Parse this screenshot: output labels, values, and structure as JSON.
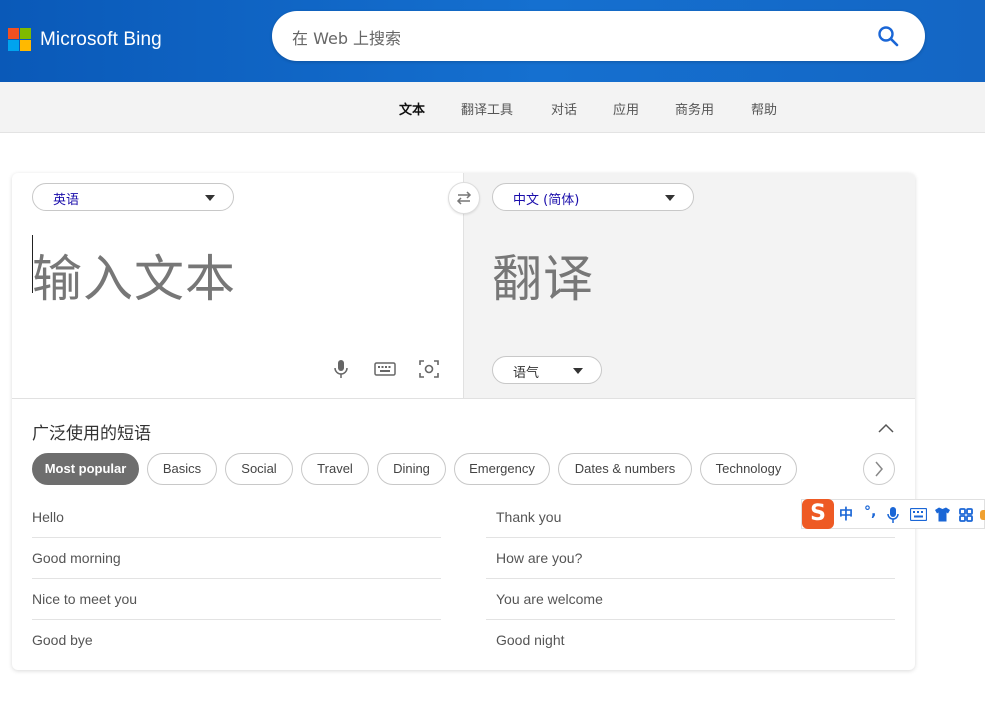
{
  "header": {
    "brand": "Microsoft Bing",
    "search_placeholder": "在 Web 上搜索",
    "logo_colors": [
      "#f25022",
      "#7fba00",
      "#00a4ef",
      "#ffb900"
    ]
  },
  "nav": {
    "items": [
      {
        "label": "文本",
        "active": true
      },
      {
        "label": "翻译工具"
      },
      {
        "label": "对话"
      },
      {
        "label": "应用"
      },
      {
        "label": "商务用"
      },
      {
        "label": "帮助"
      }
    ]
  },
  "translator": {
    "source_lang": "英语",
    "target_lang": "中文 (简体)",
    "source_placeholder": "输入文本",
    "target_placeholder": "翻译",
    "tone_label": "语气",
    "icons": [
      "microphone-icon",
      "keyboard-icon",
      "camera-scan-icon",
      "swap-icon"
    ]
  },
  "phrases": {
    "title": "广泛使用的短语",
    "categories": [
      "Most popular",
      "Basics",
      "Social",
      "Travel",
      "Dining",
      "Emergency",
      "Dates & numbers",
      "Technology"
    ],
    "left": [
      "Hello",
      "Good morning",
      "Nice to meet you",
      "Good bye"
    ],
    "right": [
      "Thank you",
      "How are you?",
      "You are welcome",
      "Good night"
    ]
  },
  "ime": {
    "logo": "S",
    "mode": "中",
    "punct": "°,"
  }
}
